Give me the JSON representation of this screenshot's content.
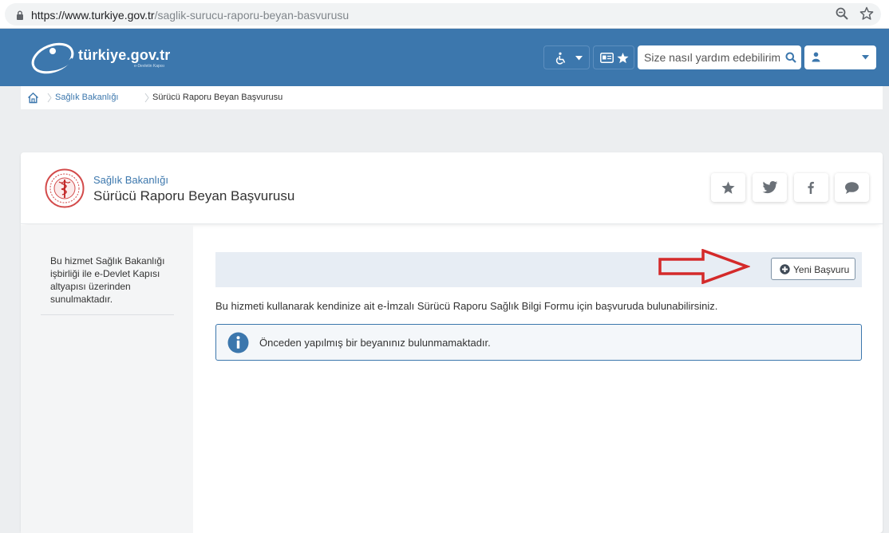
{
  "browser": {
    "url_host": "https://www.turkiye.gov.tr",
    "url_path": "/saglik-surucu-raporu-beyan-basvurusu"
  },
  "header": {
    "logo_text": "türkiye.gov.tr",
    "logo_tagline": "e-Devletin Kapısı",
    "search_placeholder": "Size nasıl yardım edebilirim?"
  },
  "breadcrumb": {
    "items": [
      "Sağlık Bakanlığı",
      "Sürücü Raporu Beyan Başvurusu"
    ]
  },
  "service": {
    "institution": "Sağlık Bakanlığı",
    "title": "Sürücü Raporu Beyan Başvurusu",
    "side_note": "Bu hizmet Sağlık Bakanlığı işbirliği ile e-Devlet Kapısı altyapısı üzerinden sunulmaktadır.",
    "new_application_label": "Yeni Başvuru",
    "description": "Bu hizmeti kullanarak kendinize ait e-İmzalı Sürücü Raporu Sağlık Bilgi Formu için başvuruda bulunabilirsiniz.",
    "info_message": "Önceden yapılmış bir beyanınız bulunmamaktadır."
  },
  "colors": {
    "brand": "#3c77ad",
    "annotation_arrow": "#d42a2a"
  }
}
